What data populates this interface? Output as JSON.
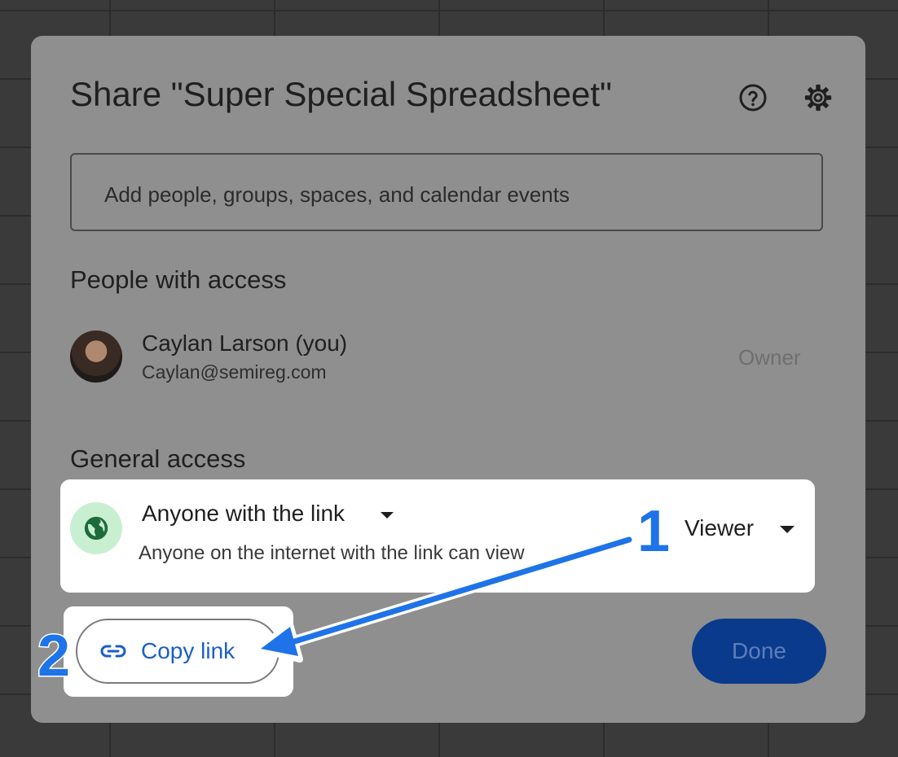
{
  "dialog": {
    "title": "Share \"Super Special Spreadsheet\"",
    "help_icon": "help-circle-icon",
    "settings_icon": "gear-icon",
    "add_people_placeholder": "Add people, groups, spaces, and calendar events"
  },
  "people_section": {
    "heading": "People with access",
    "people": [
      {
        "name": "Caylan Larson (you)",
        "email": "Caylan@semireg.com",
        "role": "Owner"
      }
    ]
  },
  "general_access": {
    "heading": "General access",
    "type": "Anyone with the link",
    "description": "Anyone on the internet with the link can view",
    "role": "Viewer",
    "icon": "globe-icon"
  },
  "actions": {
    "copy_link_label": "Copy link",
    "done_label": "Done"
  },
  "annotations": {
    "step_1": "1",
    "step_2": "2",
    "arrow_color": "#1e73e8"
  },
  "colors": {
    "accent": "#1a5fc7",
    "done_button": "#0a3a8c",
    "globe_background": "#c9efd3",
    "globe": "#1d6b3a"
  }
}
